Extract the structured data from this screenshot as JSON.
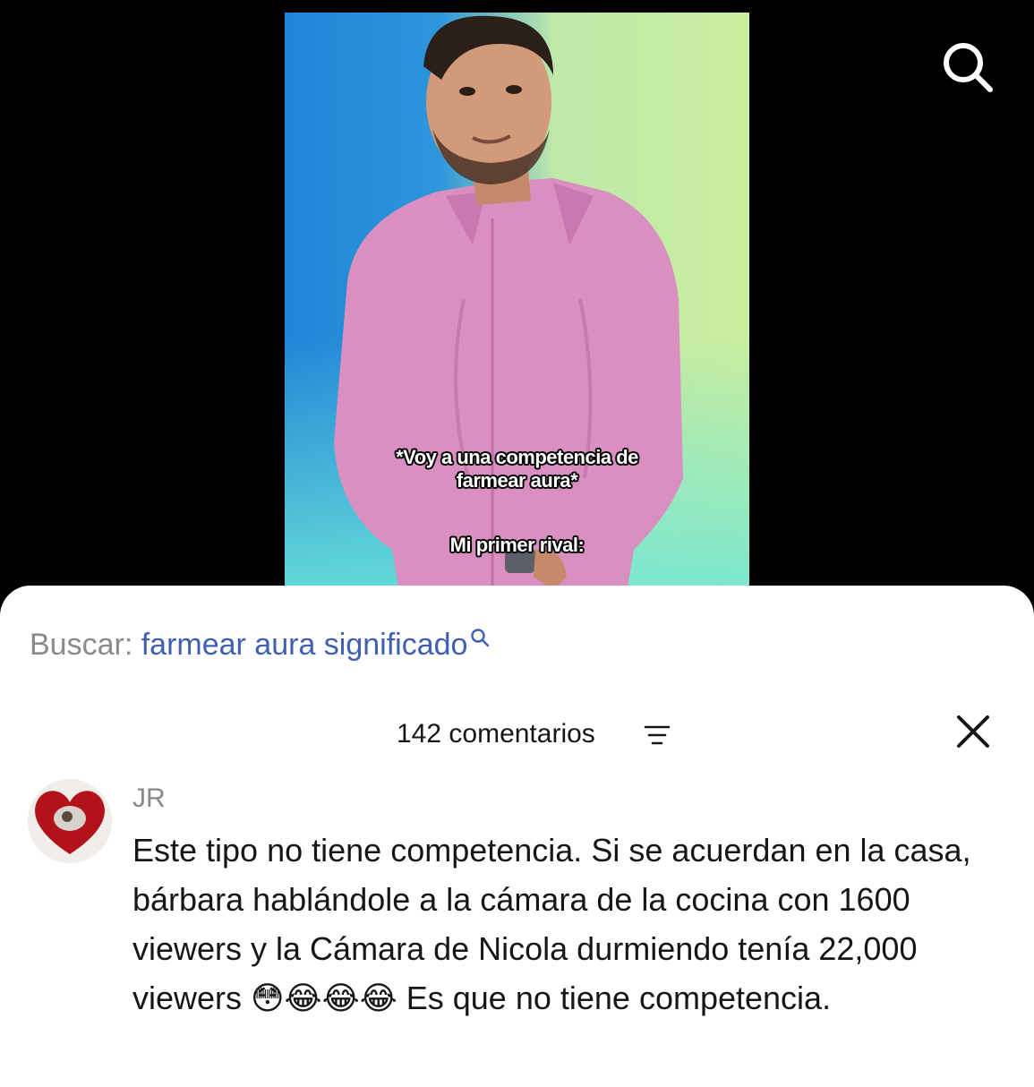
{
  "video": {
    "caption_line1": "*Voy a una competencia de",
    "caption_line2": "farmear aura*",
    "caption_line3": "Mi primer rival:"
  },
  "search_suggestion": {
    "label": "Buscar:",
    "query": "farmear aura significado",
    "icon": "search-icon"
  },
  "comments_header": {
    "count_label": "142 comentarios",
    "sort_icon": "sort-icon",
    "close_icon": "close-icon"
  },
  "comments": [
    {
      "author": "JR",
      "text": "Este tipo no tiene competencia. Si se acuerdan en la casa, bárbara hablándole a la cámara de la cocina con 1600 viewers y la Cámara de Nicola durmiendo tenía 22,000 viewers 😳😂😂😂 Es que no tiene competencia."
    }
  ],
  "colors": {
    "query_blue": "#3f5fb4",
    "muted_gray": "#8a8a8a",
    "text_dark": "#161616"
  }
}
